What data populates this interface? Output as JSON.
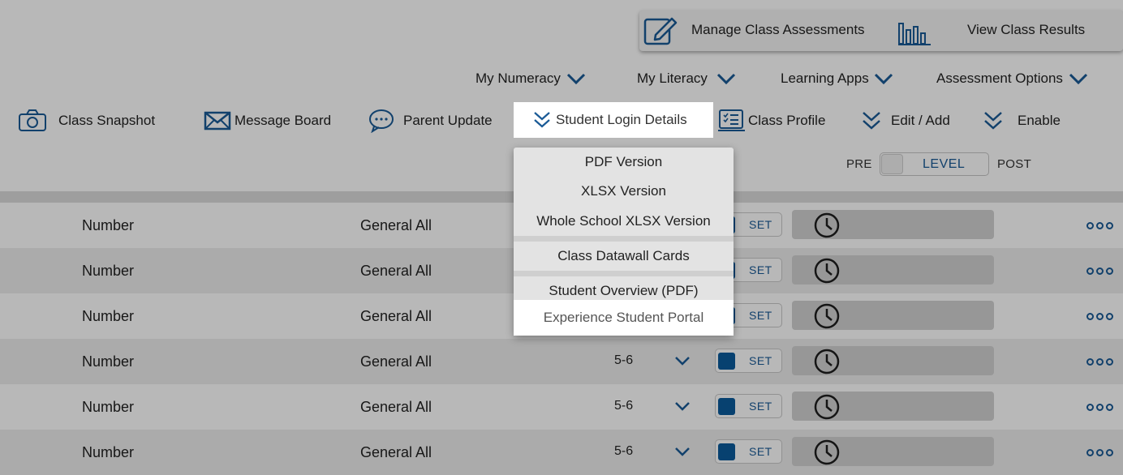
{
  "top_actions": {
    "manage_label": "Manage Class Assessments",
    "results_label": "View Class Results"
  },
  "menus": [
    {
      "label": "My Numeracy"
    },
    {
      "label": "My Literacy"
    },
    {
      "label": "Learning Apps"
    },
    {
      "label": "Assessment Options"
    }
  ],
  "toolbar": {
    "snapshot_label": "Class Snapshot",
    "message_label": "Message Board",
    "parent_label": "Parent Update",
    "login_label": "Student Login Details",
    "profile_label": "Class Profile",
    "edit_label": "Edit / Add",
    "enable_label": "Enable"
  },
  "level_toggle": {
    "pre_label": "PRE",
    "level_label": "LEVEL",
    "post_label": "POST"
  },
  "dropdown": {
    "items": [
      "PDF Version",
      "XLSX Version",
      "Whole School XLSX Version",
      "Class Datawall Cards",
      "Student Overview (PDF)",
      "Experience Student Portal"
    ]
  },
  "rows": [
    {
      "type": "Number",
      "group": "General All",
      "level": "",
      "set": "SET"
    },
    {
      "type": "Number",
      "group": "General All",
      "level": "",
      "set": "SET"
    },
    {
      "type": "Number",
      "group": "General All",
      "level": "",
      "set": "SET"
    },
    {
      "type": "Number",
      "group": "General All",
      "level": "5-6",
      "set": "SET"
    },
    {
      "type": "Number",
      "group": "General All",
      "level": "5-6",
      "set": "SET"
    },
    {
      "type": "Number",
      "group": "General All",
      "level": "5-6",
      "set": "SET"
    }
  ],
  "colors": {
    "accent": "#1a5a96",
    "toggle_on": "#0a5a9c"
  }
}
